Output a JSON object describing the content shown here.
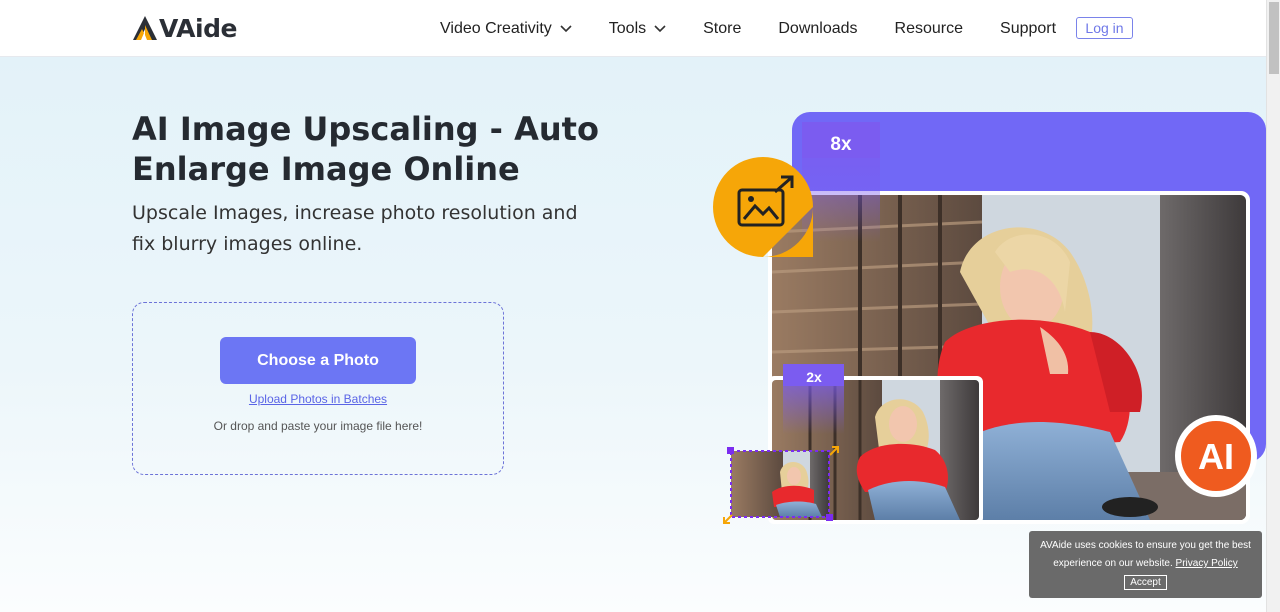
{
  "brand": {
    "name": "VAide",
    "logo_letter": "A"
  },
  "nav": {
    "items": [
      {
        "label": "Video Creativity",
        "has_dropdown": true
      },
      {
        "label": "Tools",
        "has_dropdown": true
      },
      {
        "label": "Store",
        "has_dropdown": false
      },
      {
        "label": "Downloads",
        "has_dropdown": false
      },
      {
        "label": "Resource",
        "has_dropdown": false
      },
      {
        "label": "Support",
        "has_dropdown": false
      }
    ],
    "login_label": "Log in"
  },
  "hero": {
    "title": "AI Image Upscaling - Auto Enlarge Image Online",
    "subtitle": "Upscale Images, increase photo resolution and fix blurry images online.",
    "choose_label": "Choose a Photo",
    "batch_label": "Upload Photos in Batches",
    "drop_text": "Or drop and paste your image file here!"
  },
  "illustration": {
    "badge_large": "8x",
    "badge_small": "2x",
    "ai_badge": "AI",
    "icons": [
      "image-enlarge-icon"
    ]
  },
  "cookie": {
    "text_before": "AVAide uses cookies to ensure you get the best experience on our website.",
    "policy_label": "Privacy Policy",
    "accept_label": "Accept"
  },
  "colors": {
    "accent": "#6c76f4",
    "purple": "#7b5cf0",
    "orange": "#f6a608",
    "ai_red": "#ef5b1f",
    "cookie_bg": "#6a6a6a"
  }
}
